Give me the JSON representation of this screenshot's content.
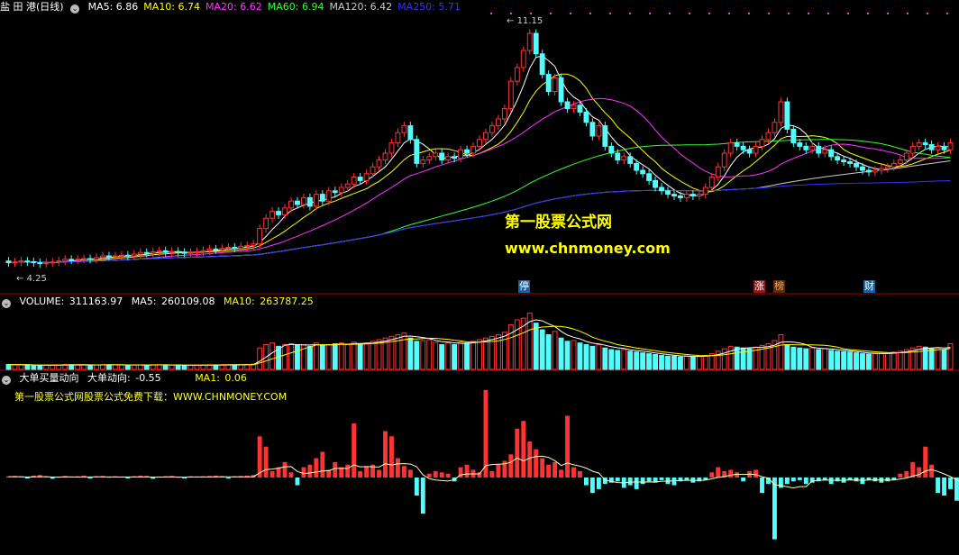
{
  "header": {
    "stock_name": "盐 田 港(日线)",
    "ma": [
      {
        "label": "MA5:",
        "value": "6.86",
        "color": "#ffffff"
      },
      {
        "label": "MA10:",
        "value": "6.74",
        "color": "#ffff00"
      },
      {
        "label": "MA20:",
        "value": "6.62",
        "color": "#ff33ff"
      },
      {
        "label": "MA60:",
        "value": "6.94",
        "color": "#33ff33"
      },
      {
        "label": "MA120:",
        "value": "6.42",
        "color": "#cccccc"
      },
      {
        "label": "MA250:",
        "value": "5.71",
        "color": "#3333ff"
      }
    ]
  },
  "price_labels": {
    "high": "11.15",
    "low": "4.25"
  },
  "events": [
    {
      "text": "停",
      "color": "#ffffff",
      "bg": "#1560a0"
    },
    {
      "text": "涨",
      "color": "#ffffff",
      "bg": "#8b1a1a"
    },
    {
      "text": "榜",
      "color": "#ffaa33",
      "bg": "#5a2a10"
    },
    {
      "text": "财",
      "color": "#ffffff",
      "bg": "#1560a0"
    }
  ],
  "volume_header": {
    "name": "VOLUME:",
    "value": "311163.97",
    "ma5_label": "MA5:",
    "ma5": "260109.08",
    "ma10_label": "MA10:",
    "ma10": "263787.25"
  },
  "indicator_header": {
    "name": "大单买量动向",
    "line_label": "大单动向:",
    "line_value": "-0.55",
    "ma_label": "MA1:",
    "ma_value": "0.06"
  },
  "watermark": {
    "line1": "第一股票公式网",
    "line2": "www.chnmoney.com"
  },
  "note": "第一股票公式网股票公式免费下载：WWW.CHNMONEY.COM",
  "colors": {
    "up": "#ff3333",
    "down": "#54fcfc",
    "divider": "#aa0000"
  },
  "chart_data": [
    {
      "type": "candlestick",
      "ylim": [
        3.5,
        11.5
      ],
      "high": 11.15,
      "low": 4.25,
      "close": [
        4.3,
        4.32,
        4.35,
        4.33,
        4.3,
        4.28,
        4.3,
        4.32,
        4.35,
        4.4,
        4.38,
        4.4,
        4.42,
        4.4,
        4.45,
        4.5,
        4.48,
        4.5,
        4.52,
        4.5,
        4.55,
        4.6,
        4.58,
        4.62,
        4.65,
        4.6,
        4.63,
        4.6,
        4.58,
        4.6,
        4.62,
        4.65,
        4.7,
        4.68,
        4.72,
        4.75,
        4.73,
        4.78,
        4.8,
        4.85,
        5.3,
        5.6,
        5.8,
        5.7,
        5.9,
        6.1,
        6.0,
        6.2,
        5.95,
        6.3,
        6.1,
        6.4,
        6.35,
        6.5,
        6.6,
        6.8,
        6.7,
        6.9,
        7.1,
        7.3,
        7.5,
        7.8,
        8.1,
        8.3,
        7.9,
        7.2,
        7.3,
        7.4,
        7.5,
        7.3,
        7.4,
        7.35,
        7.6,
        7.5,
        7.7,
        7.9,
        8.1,
        8.3,
        8.5,
        8.8,
        9.6,
        10.0,
        10.5,
        11.0,
        10.4,
        9.8,
        9.3,
        9.7,
        9.0,
        8.8,
        8.9,
        8.7,
        8.4,
        8.0,
        8.3,
        7.7,
        7.5,
        7.3,
        7.4,
        7.2,
        7.0,
        6.9,
        6.7,
        6.5,
        6.4,
        6.3,
        6.25,
        6.2,
        6.3,
        6.25,
        6.3,
        6.5,
        6.8,
        7.1,
        7.5,
        7.8,
        7.7,
        7.6,
        7.5,
        7.7,
        7.9,
        8.1,
        8.4,
        9.0,
        8.2,
        7.8,
        7.7,
        7.6,
        7.7,
        7.5,
        7.6,
        7.4,
        7.3,
        7.25,
        7.2,
        7.1,
        7.0,
        6.95,
        7.0,
        7.05,
        7.1,
        7.2,
        7.3,
        7.5,
        7.7,
        7.8,
        7.75,
        7.6,
        7.7,
        7.6,
        7.8
      ],
      "open": [
        4.35,
        4.3,
        4.32,
        4.35,
        4.33,
        4.3,
        4.28,
        4.3,
        4.32,
        4.35,
        4.4,
        4.38,
        4.4,
        4.42,
        4.4,
        4.45,
        4.5,
        4.48,
        4.5,
        4.52,
        4.5,
        4.55,
        4.6,
        4.58,
        4.62,
        4.65,
        4.6,
        4.63,
        4.6,
        4.58,
        4.6,
        4.62,
        4.65,
        4.7,
        4.68,
        4.72,
        4.75,
        4.73,
        4.78,
        4.8,
        4.85,
        5.3,
        5.6,
        5.8,
        5.7,
        5.9,
        6.1,
        6.0,
        6.2,
        5.95,
        6.3,
        6.1,
        6.4,
        6.35,
        6.5,
        6.6,
        6.8,
        6.7,
        6.9,
        7.1,
        7.3,
        7.5,
        7.8,
        8.1,
        8.3,
        7.9,
        7.2,
        7.3,
        7.4,
        7.5,
        7.3,
        7.4,
        7.35,
        7.6,
        7.5,
        7.7,
        7.9,
        8.1,
        8.3,
        8.5,
        8.8,
        9.6,
        10.0,
        10.5,
        11.0,
        10.4,
        9.8,
        9.3,
        9.7,
        9.0,
        8.8,
        8.9,
        8.7,
        8.4,
        8.0,
        8.3,
        7.7,
        7.5,
        7.3,
        7.4,
        7.2,
        7.0,
        6.9,
        6.7,
        6.5,
        6.4,
        6.3,
        6.25,
        6.2,
        6.3,
        6.25,
        6.3,
        6.5,
        6.8,
        7.1,
        7.5,
        7.8,
        7.7,
        7.6,
        7.5,
        7.7,
        7.9,
        8.1,
        8.4,
        9.0,
        8.2,
        7.8,
        7.7,
        7.6,
        7.7,
        7.5,
        7.6,
        7.4,
        7.3,
        7.25,
        7.2,
        7.1,
        7.0,
        6.95,
        7.0,
        7.05,
        7.1,
        7.2,
        7.3,
        7.5,
        7.7,
        7.8,
        7.75,
        7.6,
        7.7,
        7.6
      ],
      "ma_series": [
        {
          "name": "MA5",
          "period": 5,
          "color": "#ffffff"
        },
        {
          "name": "MA10",
          "period": 10,
          "color": "#ffff00"
        },
        {
          "name": "MA20",
          "period": 20,
          "color": "#ff33ff"
        },
        {
          "name": "MA60",
          "period": 60,
          "color": "#33ff33"
        },
        {
          "name": "MA120",
          "period": 120,
          "color": "#cccccc"
        },
        {
          "name": "MA250",
          "period": 250,
          "color": "#3333ff"
        }
      ]
    },
    {
      "type": "bar",
      "ylim": [
        0,
        720000
      ],
      "values": [
        60000,
        55000,
        58000,
        52000,
        50000,
        48000,
        50000,
        52000,
        55000,
        60000,
        58000,
        56000,
        54000,
        52000,
        55000,
        58000,
        57000,
        55000,
        53000,
        50000,
        52000,
        55000,
        53000,
        56000,
        58000,
        55000,
        52000,
        50000,
        48000,
        50000,
        52000,
        54000,
        56000,
        55000,
        57000,
        58000,
        56000,
        58000,
        60000,
        65000,
        260000,
        300000,
        320000,
        280000,
        300000,
        310000,
        290000,
        300000,
        280000,
        320000,
        290000,
        300000,
        310000,
        320000,
        300000,
        330000,
        310000,
        320000,
        340000,
        360000,
        380000,
        400000,
        420000,
        440000,
        380000,
        340000,
        350000,
        360000,
        330000,
        300000,
        320000,
        300000,
        330000,
        320000,
        340000,
        360000,
        380000,
        400000,
        420000,
        450000,
        540000,
        600000,
        620000,
        680000,
        560000,
        480000,
        420000,
        460000,
        380000,
        340000,
        350000,
        320000,
        300000,
        280000,
        300000,
        260000,
        240000,
        230000,
        240000,
        220000,
        210000,
        200000,
        190000,
        180000,
        170000,
        160000,
        160000,
        150000,
        160000,
        155000,
        160000,
        170000,
        190000,
        220000,
        250000,
        280000,
        270000,
        260000,
        250000,
        270000,
        290000,
        310000,
        350000,
        420000,
        300000,
        270000,
        260000,
        250000,
        260000,
        240000,
        250000,
        230000,
        220000,
        215000,
        210000,
        200000,
        190000,
        185000,
        190000,
        195000,
        200000,
        210000,
        220000,
        240000,
        260000,
        280000,
        270000,
        250000,
        260000,
        240000,
        311163.97
      ]
    },
    {
      "type": "bar",
      "ylim": [
        -5,
        7
      ],
      "values": [
        0.1,
        0.12,
        0.08,
        -0.05,
        0.15,
        0.2,
        0.1,
        -0.1,
        0.05,
        0.12,
        0.08,
        0.1,
        0.15,
        -0.08,
        0.1,
        0.12,
        0.05,
        0.1,
        0.08,
        -0.05,
        0.1,
        0.15,
        0.12,
        -0.1,
        0.08,
        0.1,
        0.12,
        0.05,
        -0.05,
        0.1,
        0.08,
        0.1,
        0.12,
        0.15,
        0.1,
        -0.08,
        0.1,
        0.12,
        0.15,
        0.2,
        3.2,
        2.4,
        0.5,
        0.8,
        1.2,
        0.4,
        -0.6,
        0.8,
        1.0,
        1.5,
        2.0,
        0.6,
        1.2,
        0.8,
        1.0,
        4.2,
        0.5,
        0.8,
        1.0,
        0.6,
        3.6,
        3.2,
        1.5,
        0.9,
        0.6,
        -1.4,
        -2.8,
        0.3,
        0.5,
        0.4,
        0.3,
        -0.3,
        0.8,
        1.0,
        0.6,
        0.4,
        6.8,
        0.5,
        1.0,
        1.3,
        1.8,
        3.8,
        4.4,
        2.8,
        2.2,
        1.5,
        1.0,
        1.2,
        0.6,
        4.8,
        0.8,
        0.5,
        -0.6,
        -1.2,
        -0.9,
        -0.5,
        -0.4,
        -0.3,
        -0.8,
        -0.6,
        -0.9,
        -0.5,
        -0.3,
        -0.4,
        -0.2,
        -0.5,
        -0.6,
        -0.3,
        -0.2,
        -0.4,
        -0.3,
        -0.2,
        0.4,
        0.8,
        0.5,
        0.6,
        0.4,
        -0.3,
        0.5,
        0.6,
        -1.2,
        -0.5,
        -4.8,
        -0.8,
        -0.5,
        -0.3,
        -0.2,
        -0.5,
        -0.4,
        -0.3,
        -0.2,
        -0.5,
        -0.3,
        -0.4,
        -0.2,
        -0.3,
        -0.5,
        -0.2,
        -0.3,
        -0.4,
        -0.3,
        -0.2,
        0.3,
        0.5,
        1.2,
        0.8,
        2.4,
        1.0,
        -1.2,
        -1.4,
        -0.9,
        -1.8,
        -0.55
      ],
      "line_name": "MA1",
      "line_value": 0.06
    }
  ]
}
